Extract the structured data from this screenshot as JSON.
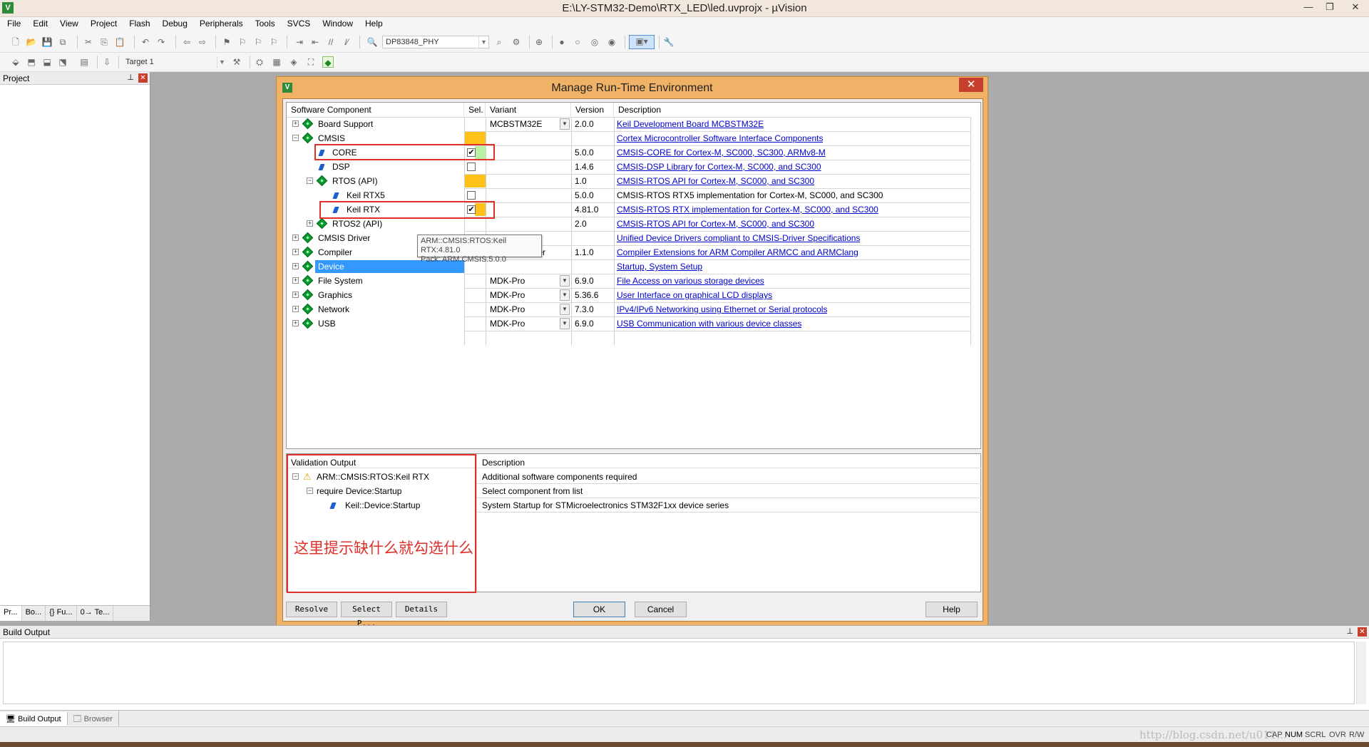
{
  "window": {
    "title": "E:\\LY-STM32-Demo\\RTX_LED\\led.uvprojx - µVision",
    "app_icon_letter": "V",
    "controls": [
      "—",
      "❐",
      "✕"
    ]
  },
  "menu": [
    "File",
    "Edit",
    "View",
    "Project",
    "Flash",
    "Debug",
    "Peripherals",
    "Tools",
    "SVCS",
    "Window",
    "Help"
  ],
  "toolbar": {
    "find_combo": "DP83848_PHY",
    "target_combo": "Target 1"
  },
  "project_panel": {
    "title": "Project",
    "tabs": [
      "Pr...",
      "Bo...",
      "{} Fu...",
      "0→ Te..."
    ]
  },
  "dialog": {
    "title": "Manage Run-Time Environment",
    "close": "✕",
    "columns": {
      "component": "Software Component",
      "sel": "Sel.",
      "variant": "Variant",
      "version": "Version",
      "description": "Description"
    },
    "rows": [
      {
        "name": "Board Support",
        "variant": "MCBSTM32E",
        "version": "2.0.0",
        "description": "Keil Development Board MCBSTM32E"
      },
      {
        "name": "CMSIS",
        "variant": "",
        "version": "",
        "description": "Cortex Microcontroller Software Interface Components"
      },
      {
        "name": "CORE",
        "variant": "",
        "version": "5.0.0",
        "description": "CMSIS-CORE for Cortex-M, SC000, SC300, ARMv8-M"
      },
      {
        "name": "DSP",
        "variant": "",
        "version": "1.4.6",
        "description": "CMSIS-DSP Library for Cortex-M, SC000, and SC300"
      },
      {
        "name": "RTOS (API)",
        "variant": "",
        "version": "1.0",
        "description": "CMSIS-RTOS API for Cortex-M, SC000, and SC300"
      },
      {
        "name": "Keil RTX5",
        "variant": "",
        "version": "5.0.0",
        "description": "CMSIS-RTOS RTX5 implementation for Cortex-M, SC000, and SC300"
      },
      {
        "name": "Keil RTX",
        "variant": "",
        "version": "4.81.0",
        "description": "CMSIS-RTOS RTX implementation for Cortex-M, SC000, and SC300"
      },
      {
        "name": "RTOS2 (API)",
        "variant": "",
        "version": "2.0",
        "description": "CMSIS-RTOS API for Cortex-M, SC000, and SC300"
      },
      {
        "name": "CMSIS Driver",
        "variant": "",
        "version": "",
        "description": "Unified Device Drivers compliant to CMSIS-Driver Specifications"
      },
      {
        "name": "Compiler",
        "variant": "ARM Compiler",
        "version": "1.1.0",
        "description": "Compiler Extensions for ARM Compiler ARMCC and ARMClang"
      },
      {
        "name": "Device",
        "variant": "",
        "version": "",
        "description": "Startup, System Setup"
      },
      {
        "name": "File System",
        "variant": "MDK-Pro",
        "version": "6.9.0",
        "description": "File Access on various storage devices"
      },
      {
        "name": "Graphics",
        "variant": "MDK-Pro",
        "version": "5.36.6",
        "description": "User Interface on graphical LCD displays"
      },
      {
        "name": "Network",
        "variant": "MDK-Pro",
        "version": "7.3.0",
        "description": "IPv4/IPv6 Networking using Ethernet or Serial protocols"
      },
      {
        "name": "USB",
        "variant": "MDK-Pro",
        "version": "6.9.0",
        "description": "USB Communication with various device classes"
      }
    ],
    "tooltip": {
      "line1": "ARM::CMSIS:RTOS:Keil RTX:4.81.0",
      "line2": "Pack: ARM.CMSIS.5.0.0"
    },
    "validation": {
      "header": "Validation Output",
      "desc_header": "Description",
      "items": [
        "ARM::CMSIS:RTOS:Keil RTX",
        "require Device:Startup",
        "Keil::Device:Startup"
      ],
      "descriptions": [
        "Additional software components required",
        "Select component from list",
        "System Startup for STMicroelectronics STM32F1xx device series"
      ],
      "annotation": "这里提示缺什么就勾选什么"
    },
    "buttons": {
      "resolve": "Resolve",
      "select_packs": "Select P...",
      "details": "Details",
      "ok": "OK",
      "cancel": "Cancel",
      "help": "Help"
    }
  },
  "build_output": {
    "title": "Build Output",
    "tabs": [
      "Build Output",
      "Browser"
    ]
  },
  "statusbar": {
    "watermark": "http://blog.csdn.net/u011...",
    "indicators": [
      "CAP",
      "NUM",
      "SCRL",
      "OVR",
      "R/W"
    ]
  }
}
